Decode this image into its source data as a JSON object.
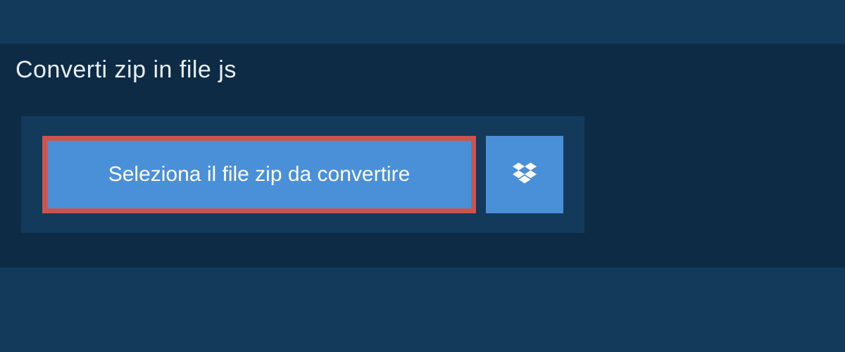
{
  "tab": {
    "title": "Converti zip in file js"
  },
  "actions": {
    "select_label": "Seleziona il file zip da convertire"
  }
}
